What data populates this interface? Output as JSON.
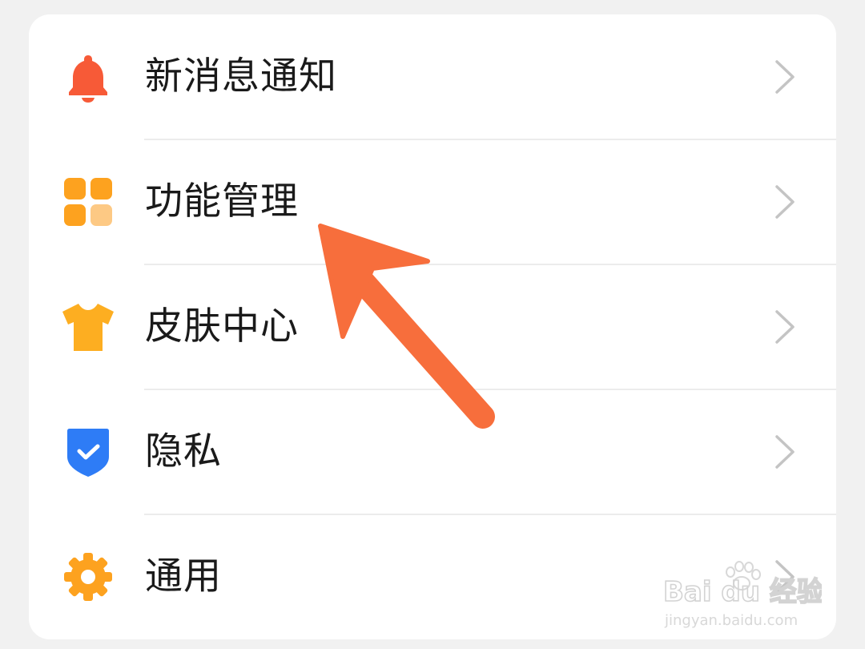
{
  "settings_list": {
    "items": [
      {
        "label": "新消息通知",
        "icon": "bell-icon",
        "icon_color": "#f75a37"
      },
      {
        "label": "功能管理",
        "icon": "grid-icon",
        "icon_color": "#fda21f"
      },
      {
        "label": "皮肤中心",
        "icon": "tshirt-icon",
        "icon_color": "#fdae21"
      },
      {
        "label": "隐私",
        "icon": "shield-check-icon",
        "icon_color": "#2e7cf6"
      },
      {
        "label": "通用",
        "icon": "gear-icon",
        "icon_color": "#fda21f"
      }
    ]
  },
  "annotation": {
    "arrow_color": "#f76e3c",
    "points_to": "功能管理"
  },
  "watermark": {
    "brand": "Bai du 经验",
    "url": "jingyan.baidu.com"
  }
}
